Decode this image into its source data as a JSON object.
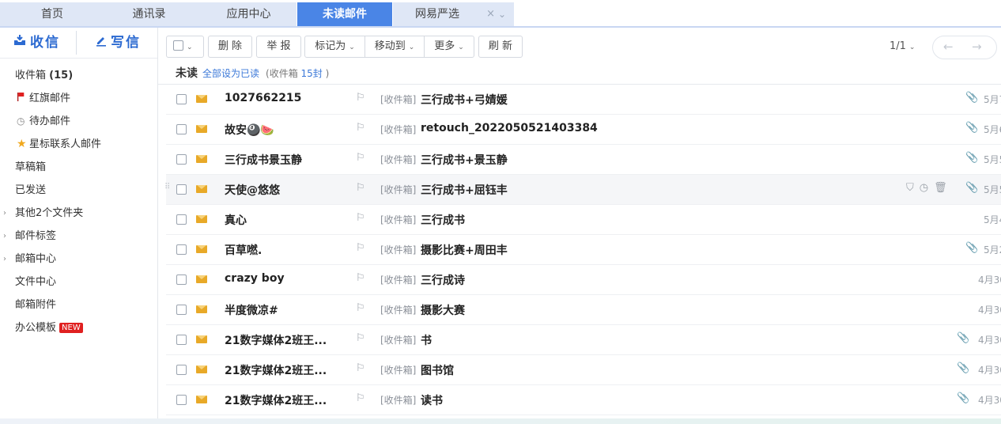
{
  "tabs": [
    {
      "label": "首页"
    },
    {
      "label": "通讯录"
    },
    {
      "label": "应用中心"
    },
    {
      "label": "未读邮件"
    },
    {
      "label": "网易严选",
      "close": "×",
      "more": "⌄"
    }
  ],
  "sidebar": {
    "receive_label": "收信",
    "compose_label": "写信",
    "items": [
      {
        "label": "收件箱",
        "count": "(15)"
      },
      {
        "label": "红旗邮件"
      },
      {
        "label": "待办邮件"
      },
      {
        "label": "星标联系人邮件"
      },
      {
        "label": "草稿箱"
      },
      {
        "label": "已发送"
      },
      {
        "label": "其他2个文件夹"
      },
      {
        "label": "邮件标签"
      },
      {
        "label": "邮箱中心"
      },
      {
        "label": "文件中心"
      },
      {
        "label": "邮箱附件"
      },
      {
        "label": "办公模板",
        "badge": "NEW"
      }
    ]
  },
  "toolbar": {
    "delete": "删 除",
    "report": "举 报",
    "mark_as": "标记为",
    "move_to": "移动到",
    "more": "更多",
    "refresh": "刷 新",
    "page": "1/1"
  },
  "filter": {
    "title": "未读",
    "mark_all_read": "全部设为已读",
    "meta_prefix": "(收件箱 ",
    "meta_count": "15封",
    "meta_suffix": " )"
  },
  "emails": [
    {
      "sender": "1027662215",
      "folder": "[收件箱]",
      "subject": "三行成书+弓婧媛",
      "date": "5月7",
      "attachment": true
    },
    {
      "sender": "故安🎱🍉",
      "folder": "[收件箱]",
      "subject": "retouch_2022050521403384",
      "date": "5月6",
      "attachment": true
    },
    {
      "sender": "三行成书景玉静",
      "folder": "[收件箱]",
      "subject": "三行成书+景玉静",
      "date": "5月5",
      "attachment": true
    },
    {
      "sender": "天使@悠悠",
      "folder": "[收件箱]",
      "subject": "三行成书+屈钰丰",
      "date": "5月5",
      "attachment": true,
      "hover": true
    },
    {
      "sender": "真心",
      "folder": "[收件箱]",
      "subject": "三行成书",
      "date": "5月4",
      "attachment": false
    },
    {
      "sender": "百草嘫.",
      "folder": "[收件箱]",
      "subject": "摄影比赛+周田丰",
      "date": "5月2",
      "attachment": true
    },
    {
      "sender": "crazy boy",
      "folder": "[收件箱]",
      "subject": "三行成诗",
      "date": "4月30",
      "attachment": false
    },
    {
      "sender": "半度微凉#",
      "folder": "[收件箱]",
      "subject": "摄影大赛",
      "date": "4月30",
      "attachment": false
    },
    {
      "sender": "21数字媒体2班王...",
      "folder": "[收件箱]",
      "subject": "书",
      "date": "4月30",
      "attachment": true
    },
    {
      "sender": "21数字媒体2班王...",
      "folder": "[收件箱]",
      "subject": "图书馆",
      "date": "4月30",
      "attachment": true
    },
    {
      "sender": "21数字媒体2班王...",
      "folder": "[收件箱]",
      "subject": "读书",
      "date": "4月30",
      "attachment": true
    }
  ]
}
